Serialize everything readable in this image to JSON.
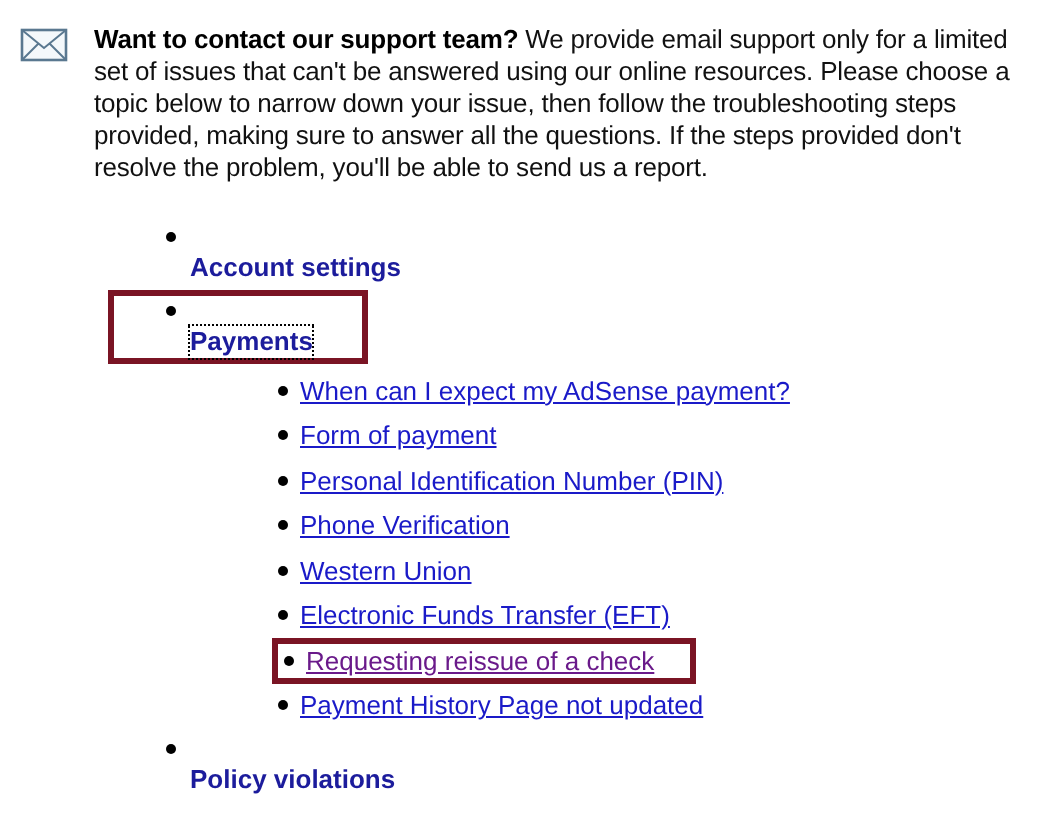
{
  "intro": "**Want to contact our support team?** We provide email support only for a limited set of issues that can't be answered using our online resources. Please choose a topic below to narrow down your issue, then follow the troubleshooting steps provided, making sure to answer all the questions. If the steps provided don't resolve the problem, you'll be able to send us a report.",
  "topics": [
    {
      "label": "Account settings",
      "highlighted": false,
      "focused": false
    },
    {
      "label": "Payments",
      "highlighted": true,
      "focused": true,
      "children": [
        {
          "label": "When can I expect my AdSense payment?",
          "visited": false,
          "highlighted": false
        },
        {
          "label": "Form of payment",
          "visited": false,
          "highlighted": false
        },
        {
          "label": "Personal Identification Number (PIN)",
          "visited": false,
          "highlighted": false
        },
        {
          "label": "Phone Verification",
          "visited": false,
          "highlighted": false
        },
        {
          "label": "Western Union",
          "visited": false,
          "highlighted": false
        },
        {
          "label": "Electronic Funds Transfer (EFT)",
          "visited": false,
          "highlighted": false
        },
        {
          "label": "Requesting reissue of a check",
          "visited": true,
          "highlighted": true
        },
        {
          "label": "Payment History Page not updated",
          "visited": false,
          "highlighted": false
        }
      ]
    },
    {
      "label": "Policy violations",
      "highlighted": false,
      "focused": false
    }
  ]
}
